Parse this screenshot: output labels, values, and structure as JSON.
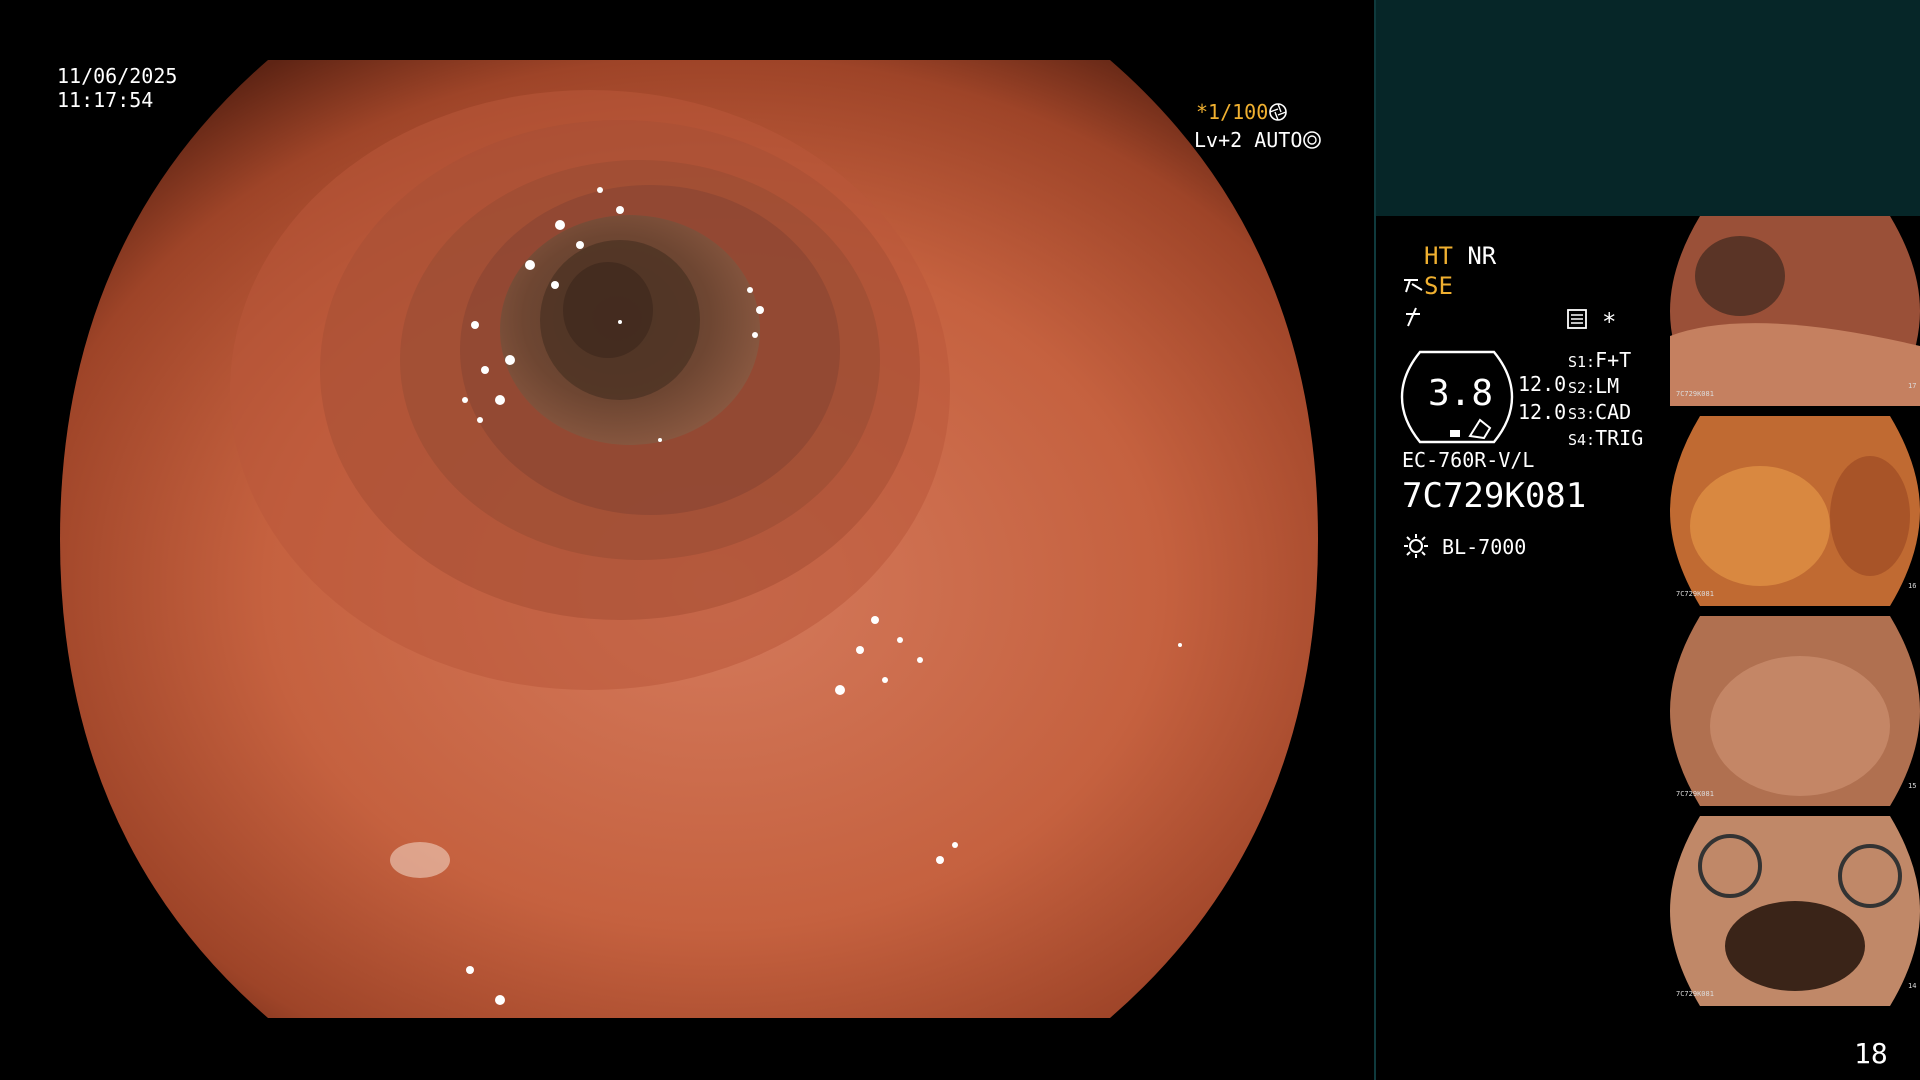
{
  "osd": {
    "date": "11/06/2025",
    "time": "11:17:54",
    "shutter": "*1/100",
    "level": "Lv+2",
    "exposure_mode": "AUTO",
    "shutter_icon": "aperture-icon",
    "auto_icon": "iris-icon"
  },
  "settings": {
    "ht_label": "HT",
    "nr_label": "NR",
    "se_label": "SE",
    "asterisk": "*",
    "zoom_value": "3.8",
    "value_top": "12.0",
    "value_bottom": "12.0",
    "switches": [
      {
        "key": "S1:",
        "value": "F+T"
      },
      {
        "key": "S2:",
        "value": "LM"
      },
      {
        "key": "S3:",
        "value": "CAD"
      },
      {
        "key": "S4:",
        "value": "TRIG"
      }
    ],
    "scope_model": "EC-760R-V/L",
    "scope_serial": "7C729K081",
    "light_source": "BL-7000"
  },
  "thumbnails": [
    {
      "index": "17",
      "serial": "7C729K081"
    },
    {
      "index": "16",
      "serial": "7C729K081"
    },
    {
      "index": "15",
      "serial": "7C729K081"
    },
    {
      "index": "14",
      "serial": "7C729K081"
    }
  ],
  "image_count": "18",
  "colors": {
    "panel_bg": "#062628",
    "highlight": "#f0b030",
    "tissue": "#c8674a"
  }
}
